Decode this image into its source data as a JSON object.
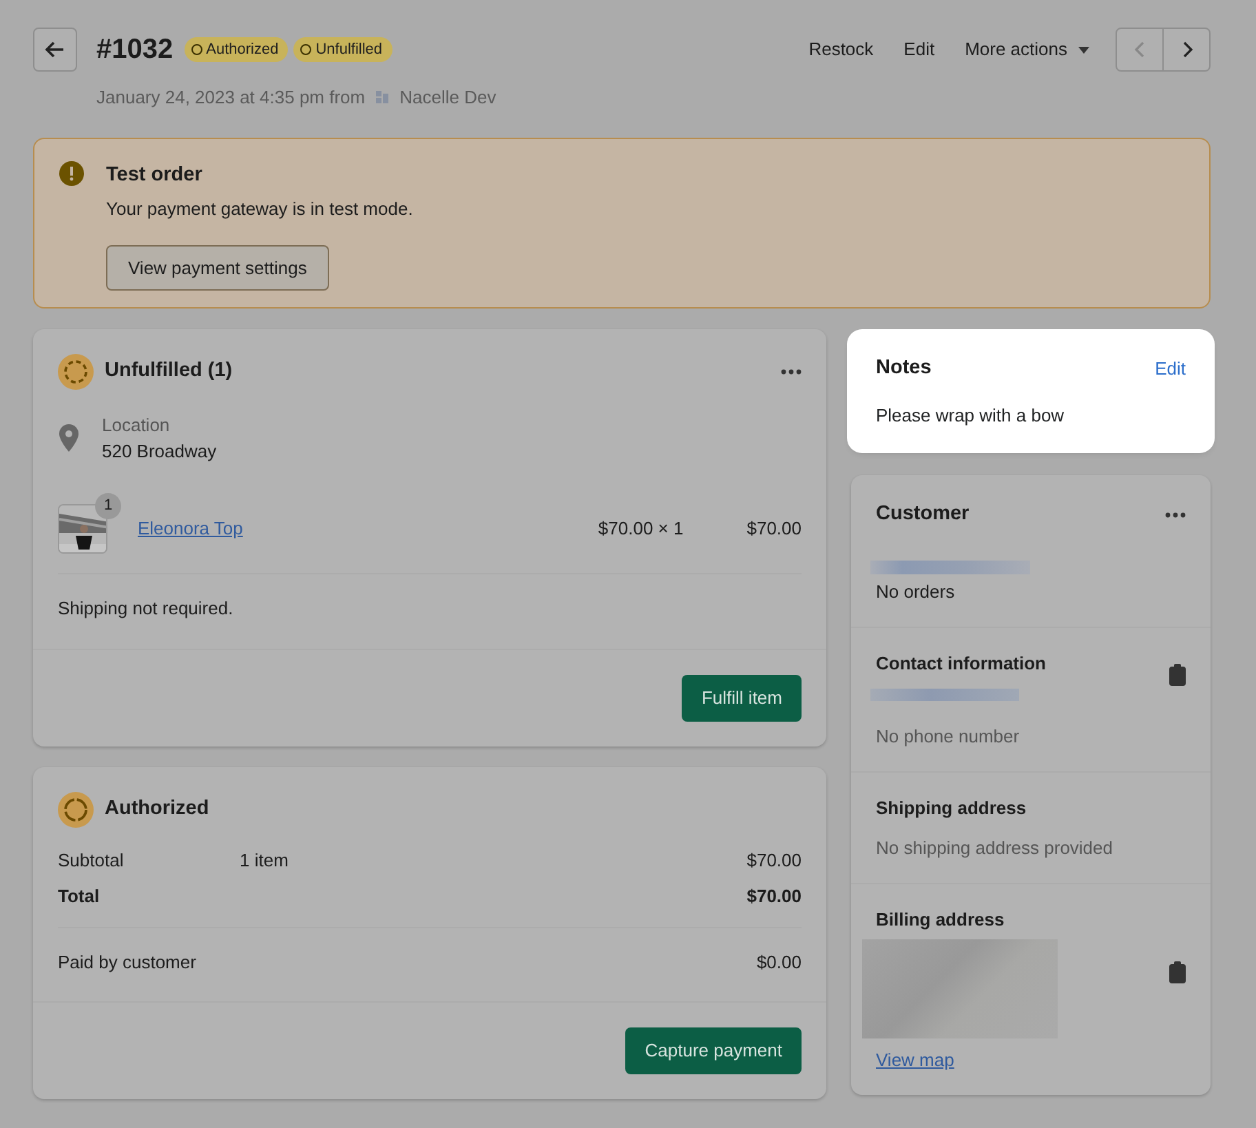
{
  "header": {
    "order_number": "#1032",
    "badges": [
      {
        "label": "Authorized"
      },
      {
        "label": "Unfulfilled"
      }
    ],
    "subtitle": "January 24, 2023 at 4:35 pm from",
    "channel": "Nacelle Dev",
    "actions": [
      "Restock",
      "Edit",
      "More actions"
    ]
  },
  "banner": {
    "title": "Test order",
    "message": "Your payment gateway is in test mode.",
    "button": "View payment settings"
  },
  "fulfillment": {
    "title": "Unfulfilled (1)",
    "location_label": "Location",
    "location": "520 Broadway",
    "items": [
      {
        "quantity": "1",
        "name": "Eleonora Top",
        "price": "$70.00 × 1",
        "total": "$70.00"
      }
    ],
    "shipping_note": "Shipping not required.",
    "button": "Fulfill item"
  },
  "payment": {
    "title": "Authorized",
    "rows": [
      {
        "label": "Subtotal",
        "detail": "1 item",
        "amount": "$70.00",
        "bold": false
      },
      {
        "label": "Total",
        "amount": "$70.00",
        "bold": true
      }
    ],
    "paid_label": "Paid by customer",
    "paid_amount": "$0.00",
    "button": "Capture payment"
  },
  "notes": {
    "title": "Notes",
    "edit": "Edit",
    "text": "Please wrap with a bow",
    "highlighted": true
  },
  "customer": {
    "title": "Customer",
    "orders": "No orders",
    "sections": [
      {
        "title": "Contact information",
        "kind": "line",
        "copyable": true,
        "note": "No phone number"
      },
      {
        "title": "Shipping address",
        "kind": "plain",
        "copyable": false,
        "note": "No shipping address provided"
      },
      {
        "title": "Billing address",
        "kind": "block",
        "copyable": true,
        "link": "View map"
      }
    ]
  }
}
